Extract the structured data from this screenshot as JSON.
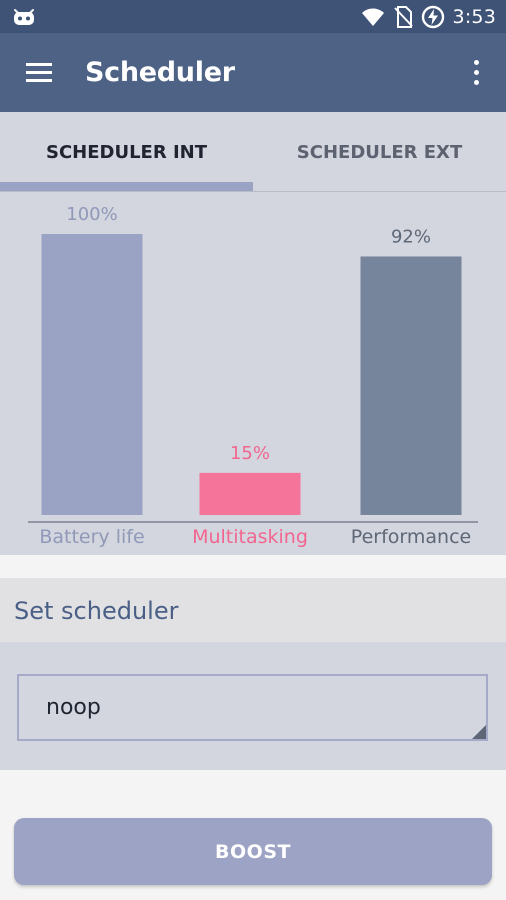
{
  "status_bar": {
    "time": "3:53",
    "icons": [
      "android-icon",
      "wifi-icon",
      "no-sim-icon",
      "battery-charging-icon"
    ]
  },
  "app_bar": {
    "title": "Scheduler",
    "icons": [
      "menu-icon",
      "more-vert-icon"
    ]
  },
  "tabs": [
    {
      "label": "SCHEDULER INT",
      "active": true
    },
    {
      "label": "SCHEDULER EXT",
      "active": false
    }
  ],
  "chart_data": {
    "type": "bar",
    "categories": [
      "Battery life",
      "Multitasking",
      "Performance"
    ],
    "values": [
      100,
      15,
      92
    ],
    "value_labels": [
      "100%",
      "15%",
      "92%"
    ],
    "colors": [
      "#9ba3c5",
      "#f47599",
      "#76849c"
    ],
    "label_colors": [
      "#9199b9",
      "#f2668f",
      "#5e6876"
    ],
    "ylim": [
      0,
      100
    ],
    "grid": false
  },
  "scheduler": {
    "section_label": "Set scheduler",
    "selected_value": "noop"
  },
  "boost_button": {
    "label": "BOOST"
  },
  "colors": {
    "status_bar": "#3f5377",
    "app_bar": "#4d6285",
    "panel": "#d3d5df",
    "accent": "#9ba3c5"
  }
}
